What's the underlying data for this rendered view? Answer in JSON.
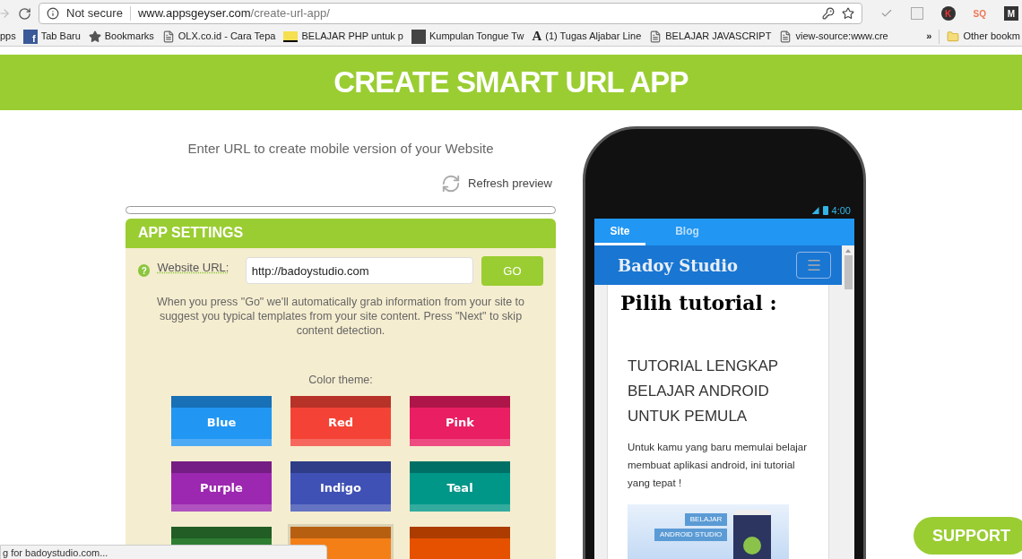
{
  "browser": {
    "security": "Not secure",
    "url_host": "www.appsgeyser.com",
    "url_path": "/create-url-app/",
    "bookmarks": [
      {
        "kind": "apps",
        "label": "pps"
      },
      {
        "kind": "facebook",
        "glyph": "f",
        "label": "Tab Baru"
      },
      {
        "kind": "star",
        "label": "Bookmarks"
      },
      {
        "kind": "page",
        "label": "OLX.co.id - Cara Tepa"
      },
      {
        "kind": "php",
        "label": "BELAJAR PHP untuk p"
      },
      {
        "kind": "thumb",
        "label": "Kumpulan Tongue Tw"
      },
      {
        "kind": "font",
        "glyph": "A",
        "label": "(1) Tugas Aljabar Line"
      },
      {
        "kind": "page",
        "label": "BELAJAR JAVASCRIPT"
      },
      {
        "kind": "page",
        "label": "view-source:www.cre"
      }
    ],
    "more": "»",
    "other": "Other bookm",
    "extensions": [
      {
        "kind": "circle",
        "label": "K"
      },
      {
        "kind": "plain",
        "label": "SQ"
      },
      {
        "kind": "square",
        "label": "M"
      }
    ]
  },
  "banner": {
    "title": "CREATE SMART URL APP"
  },
  "intro": "Enter URL to create mobile version of your Website",
  "refresh": "Refresh preview",
  "settings": {
    "title": "APP SETTINGS",
    "help": "?",
    "url_label": "Website URL:",
    "url_value": "http://badoystudio.com",
    "go": "GO",
    "hint": "When you press \"Go\" we'll automatically grab information from your site to suggest you typical templates from your site content. Press \"Next\" to skip content detection.",
    "theme_label": "Color theme:",
    "themes": [
      {
        "name": "Blue",
        "color": "#2196f3",
        "selected": false
      },
      {
        "name": "Red",
        "color": "#f44336",
        "selected": false
      },
      {
        "name": "Pink",
        "color": "#e91e63",
        "selected": false
      },
      {
        "name": "Purple",
        "color": "#9c27b0",
        "selected": false
      },
      {
        "name": "Indigo",
        "color": "#3f51b5",
        "selected": false
      },
      {
        "name": "Teal",
        "color": "#009688",
        "selected": false
      },
      {
        "color": "#2e7d32",
        "selected": false
      },
      {
        "color": "#f57f17",
        "selected": true
      },
      {
        "color": "#e65100",
        "selected": false
      }
    ]
  },
  "phone": {
    "time": "4:00",
    "tabs": [
      {
        "label": "Site",
        "selected": true
      },
      {
        "label": "Blog",
        "selected": false
      }
    ],
    "site_title": "Badoy Studio",
    "page_title": "Pilih tutorial :",
    "post_title": "TUTORIAL LENGKAP BELAJAR ANDROID UNTUK PEMULA",
    "post_text": "Untuk kamu yang baru memulai belajar membuat aplikasi android, ini tutorial yang tepat !",
    "image_labels": [
      "BELAJAR",
      "ANDROID STUDIO"
    ]
  },
  "support": "SUPPORT",
  "status": "g for badoystudio.com..."
}
